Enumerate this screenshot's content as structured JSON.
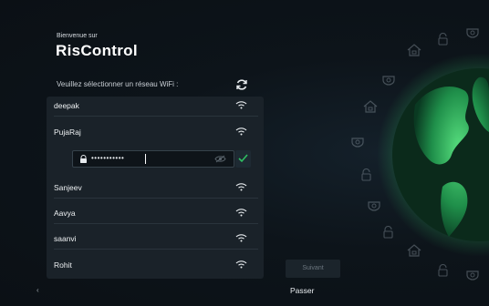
{
  "header": {
    "welcome": "Bienvenue sur",
    "brand": "RisControl"
  },
  "wifi": {
    "prompt": "Veuillez sélectionner un réseau WiFi :",
    "networks": [
      {
        "name": "deepak"
      },
      {
        "name": "PujaRaj"
      },
      {
        "name": "Sanjeev"
      },
      {
        "name": "Aavya"
      },
      {
        "name": "saanvi"
      },
      {
        "name": "Rohit"
      }
    ],
    "password_value": "•••••••••••"
  },
  "footer": {
    "next_label": "Suivant",
    "skip_label": "Passer",
    "back_label": "‹"
  },
  "colors": {
    "background": "#0c1116",
    "accent_green": "#2fbf63",
    "list_bg": "#1a2229"
  },
  "icons": [
    "refresh-icon",
    "wifi-icon",
    "lock-icon",
    "eye-icon",
    "check-icon",
    "house-icon",
    "padlock-icon",
    "camera-icon",
    "globe"
  ]
}
